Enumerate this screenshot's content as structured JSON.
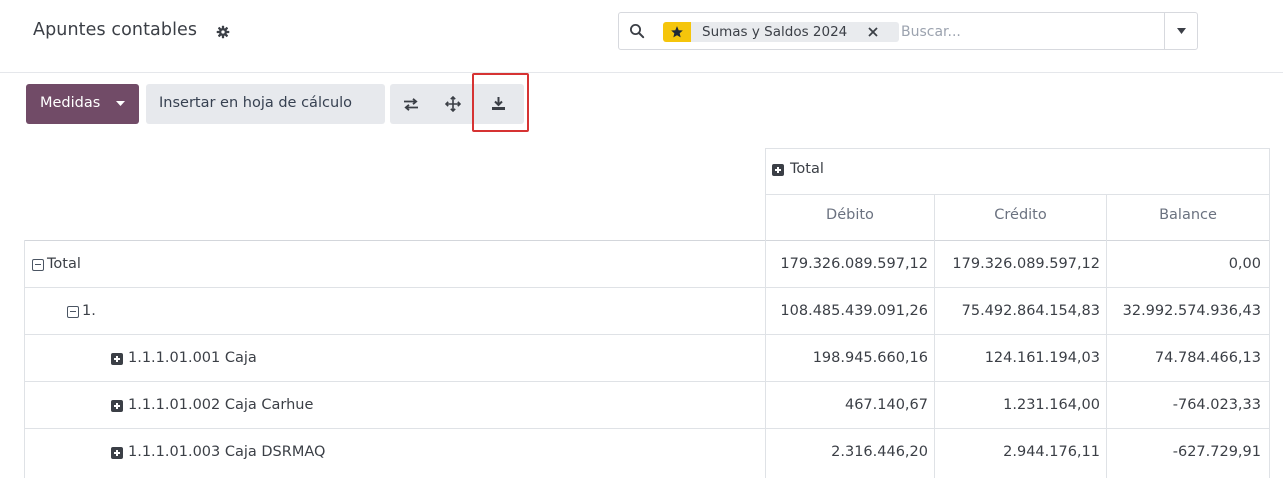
{
  "header": {
    "title": "Apuntes contables",
    "gear_icon": "gear-icon"
  },
  "search": {
    "search_icon": "search-icon",
    "facet": {
      "icon": "star-icon",
      "label": "Sumas y Saldos 2024"
    },
    "placeholder": "Buscar...",
    "toggle_icon": "caret-down-icon"
  },
  "toolbar": {
    "measures_label": "Medidas",
    "insert_label": "Insertar en hoja de cálculo",
    "flip_icon": "flip-axis-icon",
    "expand_icon": "expand-all-icon",
    "download_icon": "download-icon"
  },
  "pivot": {
    "col_group": "Total",
    "columns": [
      "Débito",
      "Crédito",
      "Balance"
    ],
    "rows": [
      {
        "label": "Total",
        "values": [
          "179.326.089.597,12",
          "179.326.089.597,12",
          "0,00"
        ]
      },
      {
        "label": "1.",
        "values": [
          "108.485.439.091,26",
          "75.492.864.154,83",
          "32.992.574.936,43"
        ]
      },
      {
        "label": "1.1.1.01.001 Caja",
        "values": [
          "198.945.660,16",
          "124.161.194,03",
          "74.784.466,13"
        ]
      },
      {
        "label": "1.1.1.01.002 Caja Carhue",
        "values": [
          "467.140,67",
          "1.231.164,00",
          "-764.023,33"
        ]
      },
      {
        "label": "1.1.1.01.003 Caja DSRMAQ",
        "values": [
          "2.316.446,20",
          "2.944.176,11",
          "-627.729,91"
        ]
      }
    ]
  },
  "colors": {
    "primary": "#714b67",
    "facet_star": "#f5c50b",
    "highlight": "#d63333"
  }
}
